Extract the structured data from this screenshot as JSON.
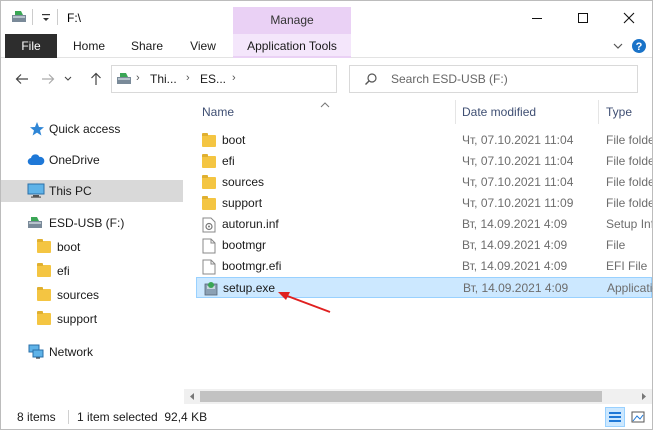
{
  "window": {
    "title": "F:\\",
    "contextual_group": "Manage"
  },
  "ribbon": {
    "tabs": [
      {
        "label": "File"
      },
      {
        "label": "Home"
      },
      {
        "label": "Share"
      },
      {
        "label": "View"
      },
      {
        "label": "Application Tools"
      }
    ]
  },
  "address": {
    "crumbs": [
      "Thi...",
      "ES..."
    ],
    "search_placeholder": "Search ESD-USB (F:)"
  },
  "nav": {
    "items": [
      {
        "label": "Quick access",
        "icon": "star-icon"
      },
      {
        "label": "OneDrive",
        "icon": "cloud-icon"
      },
      {
        "label": "This PC",
        "icon": "monitor-icon",
        "selected": true
      },
      {
        "label": "ESD-USB (F:)",
        "icon": "drive-icon"
      },
      {
        "label": "boot",
        "icon": "folder-icon"
      },
      {
        "label": "efi",
        "icon": "folder-icon"
      },
      {
        "label": "sources",
        "icon": "folder-icon"
      },
      {
        "label": "support",
        "icon": "folder-icon"
      },
      {
        "label": "Network",
        "icon": "network-icon"
      }
    ]
  },
  "list": {
    "columns": {
      "name": "Name",
      "date": "Date modified",
      "type": "Type"
    },
    "rows": [
      {
        "name": "boot",
        "date": "Чт, 07.10.2021 11:04",
        "type": "File folder",
        "icon": "folder-icon"
      },
      {
        "name": "efi",
        "date": "Чт, 07.10.2021 11:04",
        "type": "File folder",
        "icon": "folder-icon"
      },
      {
        "name": "sources",
        "date": "Чт, 07.10.2021 11:04",
        "type": "File folder",
        "icon": "folder-icon"
      },
      {
        "name": "support",
        "date": "Чт, 07.10.2021 11:09",
        "type": "File folder",
        "icon": "folder-icon"
      },
      {
        "name": "autorun.inf",
        "date": "Вт, 14.09.2021 4:09",
        "type": "Setup Information",
        "icon": "setup-info-file-icon"
      },
      {
        "name": "bootmgr",
        "date": "Вт, 14.09.2021 4:09",
        "type": "File",
        "icon": "blank-file-icon"
      },
      {
        "name": "bootmgr.efi",
        "date": "Вт, 14.09.2021 4:09",
        "type": "EFI File",
        "icon": "blank-file-icon"
      },
      {
        "name": "setup.exe",
        "date": "Вт, 14.09.2021 4:09",
        "type": "Application",
        "icon": "setup-app-icon",
        "selected": true
      }
    ]
  },
  "status": {
    "count": "8 items",
    "selection": "1 item selected  92,4 KB"
  },
  "colors": {
    "accent_selection": "#cce8ff",
    "manage_tab": "#ead1f5",
    "folder": "#f4c542",
    "annotation_arrow": "#e02020"
  }
}
